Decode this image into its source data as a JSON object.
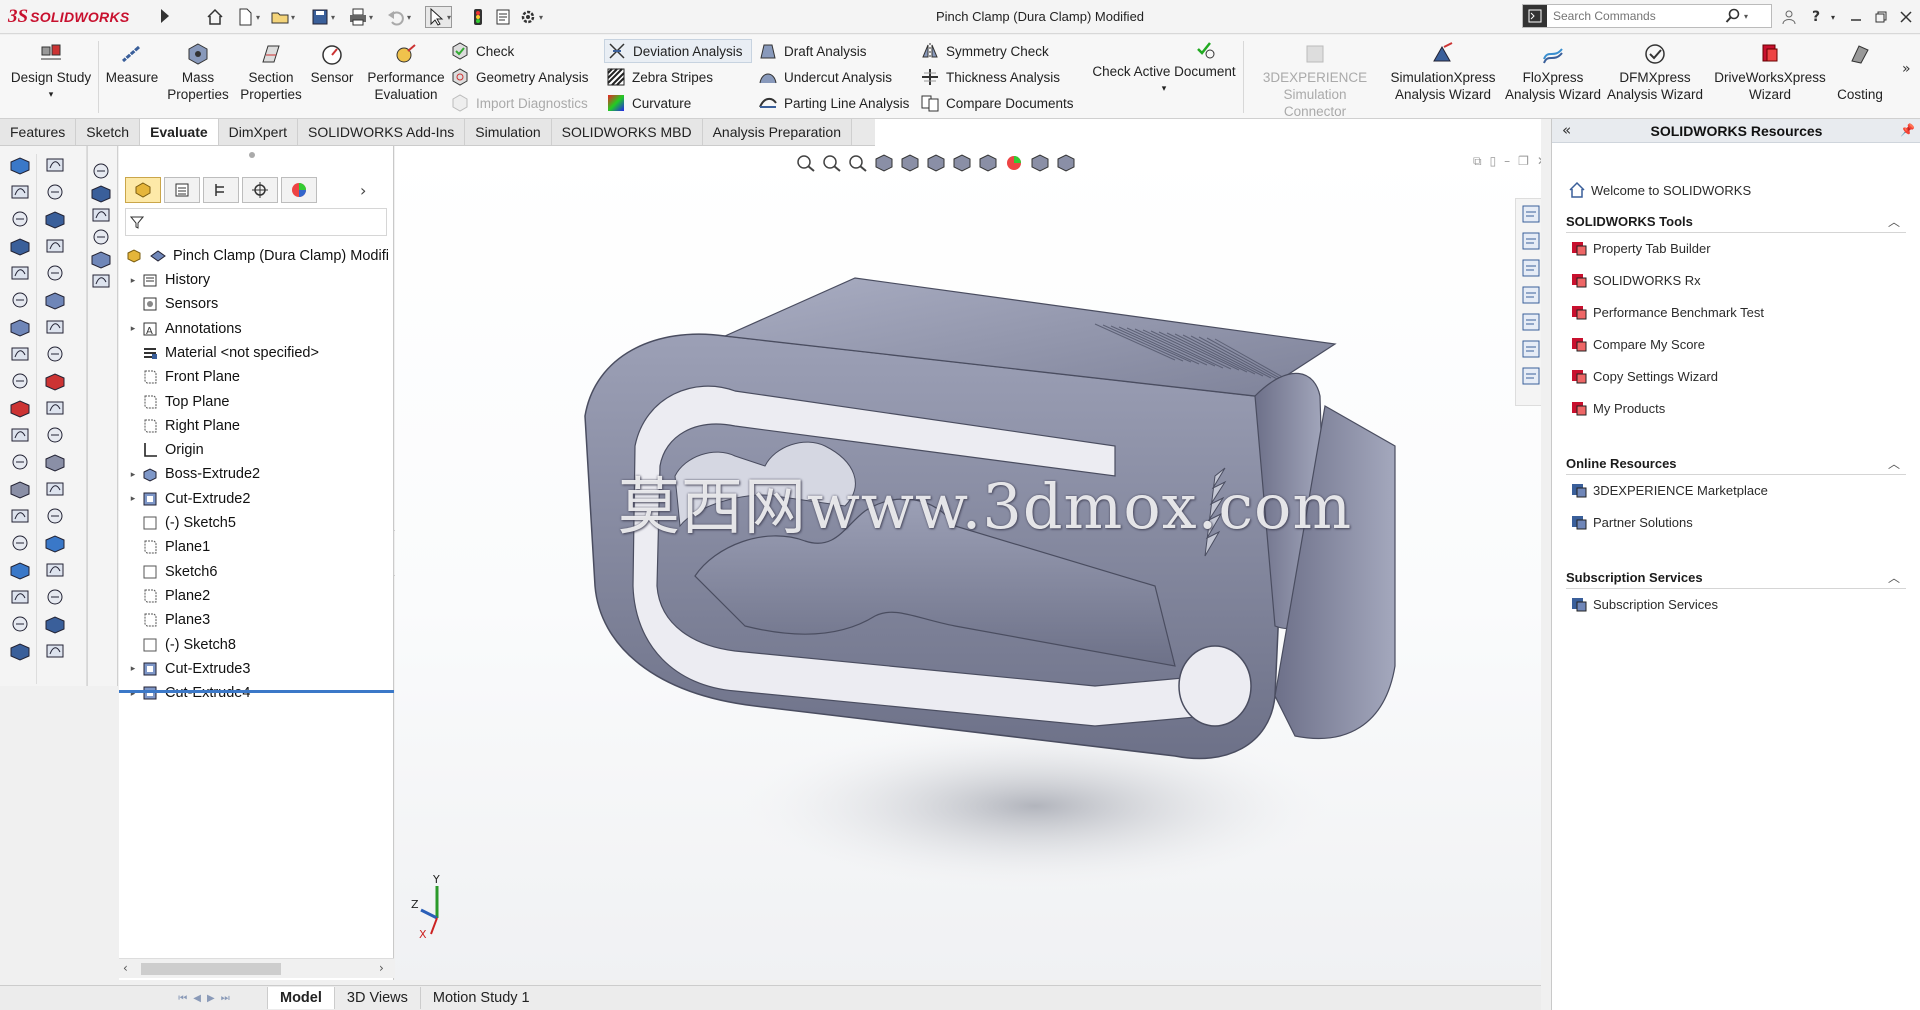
{
  "app": {
    "brand_prefix": "3S",
    "brand_name": "SOLIDWORKS",
    "document_title": "Pinch Clamp (Dura Clamp) Modified",
    "search_placeholder": "Search Commands"
  },
  "ribbon": {
    "large_buttons": [
      {
        "id": "design-study",
        "label": "Design Study",
        "dropdown": "▾"
      },
      {
        "id": "measure",
        "label": "Measure"
      },
      {
        "id": "mass-properties",
        "label": "Mass Properties"
      },
      {
        "id": "section-properties",
        "label": "Section Properties"
      },
      {
        "id": "sensor",
        "label": "Sensor"
      },
      {
        "id": "performance-evaluation",
        "label": "Performance Evaluation"
      }
    ],
    "small_items": [
      {
        "id": "check",
        "label": "Check"
      },
      {
        "id": "geometry-analysis",
        "label": "Geometry Analysis"
      },
      {
        "id": "import-diagnostics",
        "label": "Import Diagnostics"
      },
      {
        "id": "deviation-analysis",
        "label": "Deviation Analysis"
      },
      {
        "id": "zebra-stripes",
        "label": "Zebra Stripes"
      },
      {
        "id": "curvature",
        "label": "Curvature"
      },
      {
        "id": "draft-analysis",
        "label": "Draft Analysis"
      },
      {
        "id": "undercut-analysis",
        "label": "Undercut Analysis"
      },
      {
        "id": "parting-line-analysis",
        "label": "Parting Line Analysis"
      },
      {
        "id": "symmetry-check",
        "label": "Symmetry Check"
      },
      {
        "id": "thickness-analysis",
        "label": "Thickness Analysis"
      },
      {
        "id": "compare-documents",
        "label": "Compare Documents"
      }
    ],
    "check_active_document": "Check Active Document",
    "check_active_dropdown": "▾",
    "right_buttons": [
      {
        "id": "3dexperience-sim",
        "label": "3DEXPERIENCE Simulation Connector"
      },
      {
        "id": "simulationxpress",
        "label": "SimulationXpress Analysis Wizard"
      },
      {
        "id": "floxpress",
        "label": "FloXpress Analysis Wizard"
      },
      {
        "id": "dfmxpress",
        "label": "DFMXpress Analysis Wizard"
      },
      {
        "id": "driveworksxpress",
        "label": "DriveWorksXpress Wizard"
      },
      {
        "id": "costing",
        "label": "Costing"
      }
    ],
    "overflow": "»"
  },
  "tabs": [
    {
      "label": "Features"
    },
    {
      "label": "Sketch"
    },
    {
      "label": "Evaluate",
      "active": true
    },
    {
      "label": "DimXpert"
    },
    {
      "label": "SOLIDWORKS Add-Ins"
    },
    {
      "label": "Simulation"
    },
    {
      "label": "SOLIDWORKS MBD"
    },
    {
      "label": "Analysis Preparation"
    }
  ],
  "feature_tree": {
    "collapse_arrow": "›",
    "root": "Pinch Clamp (Dura Clamp) Modifi",
    "items": [
      {
        "label": "History",
        "icon": "history-icon",
        "expandable": true
      },
      {
        "label": "Sensors",
        "icon": "sensor-icon",
        "expandable": false
      },
      {
        "label": "Annotations",
        "icon": "annotations-icon",
        "expandable": true
      },
      {
        "label": "Material <not specified>",
        "icon": "material-icon",
        "expandable": false
      },
      {
        "label": "Front Plane",
        "icon": "plane-icon",
        "expandable": false
      },
      {
        "label": "Top Plane",
        "icon": "plane-icon",
        "expandable": false
      },
      {
        "label": "Right Plane",
        "icon": "plane-icon",
        "expandable": false
      },
      {
        "label": "Origin",
        "icon": "origin-icon",
        "expandable": false
      },
      {
        "label": "Boss-Extrude2",
        "icon": "boss-extrude-icon",
        "expandable": true
      },
      {
        "label": "Cut-Extrude2",
        "icon": "cut-extrude-icon",
        "expandable": true
      },
      {
        "label": "(-) Sketch5",
        "icon": "sketch-icon",
        "expandable": false
      },
      {
        "label": "Plane1",
        "icon": "plane-icon",
        "expandable": false
      },
      {
        "label": "Sketch6",
        "icon": "sketch-icon",
        "expandable": false
      },
      {
        "label": "Plane2",
        "icon": "plane-icon",
        "expandable": false
      },
      {
        "label": "Plane3",
        "icon": "plane-icon",
        "expandable": false
      },
      {
        "label": "(-) Sketch8",
        "icon": "sketch-icon",
        "expandable": false
      },
      {
        "label": "Cut-Extrude3",
        "icon": "cut-extrude-icon",
        "expandable": true
      },
      {
        "label": "Cut-Extrude4",
        "icon": "cut-extrude-icon",
        "expandable": true
      }
    ]
  },
  "viewport": {
    "watermark": "莫西网www.3dmox.com",
    "triad": {
      "x": "X",
      "y": "Y",
      "z": "Z"
    }
  },
  "bottom_tabs": [
    {
      "label": "Model",
      "active": true
    },
    {
      "label": "3D Views"
    },
    {
      "label": "Motion Study 1"
    }
  ],
  "resources": {
    "title": "SOLIDWORKS Resources",
    "welcome": "Welcome to SOLIDWORKS",
    "sections": [
      {
        "title": "SOLIDWORKS Tools",
        "items": [
          "Property Tab Builder",
          "SOLIDWORKS Rx",
          "Performance Benchmark Test",
          "Compare My Score",
          "Copy Settings Wizard",
          "My Products"
        ]
      },
      {
        "title": "Online Resources",
        "items": [
          "3DEXPERIENCE Marketplace",
          "Partner Solutions"
        ]
      },
      {
        "title": "Subscription Services",
        "items": [
          "Subscription Services"
        ]
      }
    ]
  },
  "colors": {
    "brand": "#c8102e",
    "part_face": "#8a8fa6",
    "selection": "#3b78c8"
  }
}
